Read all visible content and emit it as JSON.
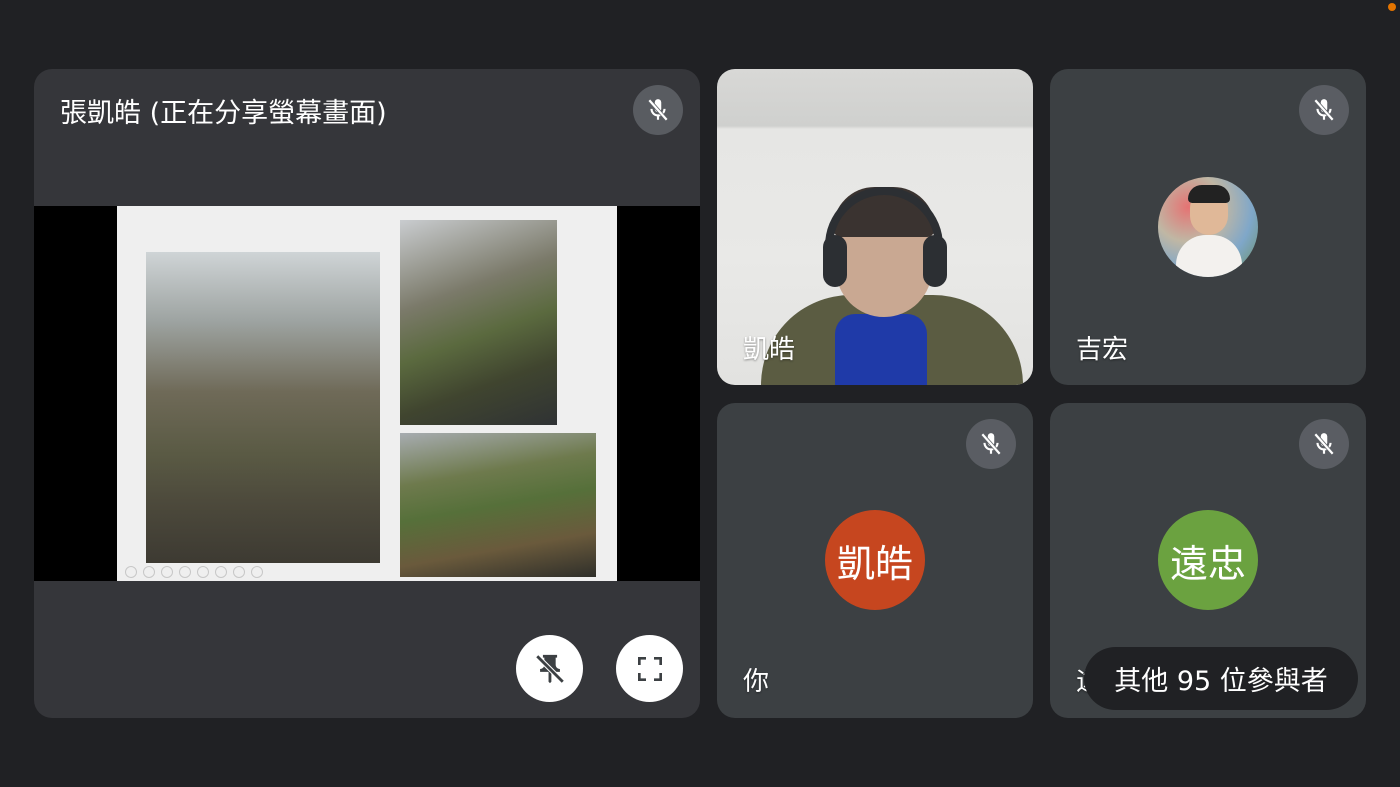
{
  "presenter": {
    "title": "張凱皓 (正在分享螢幕畫面)",
    "mic_icon": "mic-off-icon"
  },
  "controls": {
    "pin_icon": "unpin-icon",
    "fullscreen_icon": "fullscreen-icon"
  },
  "participants": [
    {
      "name": "凱皓",
      "muted": false
    },
    {
      "name": "吉宏",
      "muted": true
    },
    {
      "name": "你",
      "initials": "凱皓",
      "avatar_color": "#c6461f",
      "muted": true
    },
    {
      "name": "遠",
      "initials": "遠忠",
      "avatar_color": "#6ba240",
      "muted": true
    }
  ],
  "others": {
    "label": "其他 95 位參與者"
  },
  "colors": {
    "background": "#202124",
    "tile": "#3c4043",
    "recording_dot": "#e37400"
  }
}
